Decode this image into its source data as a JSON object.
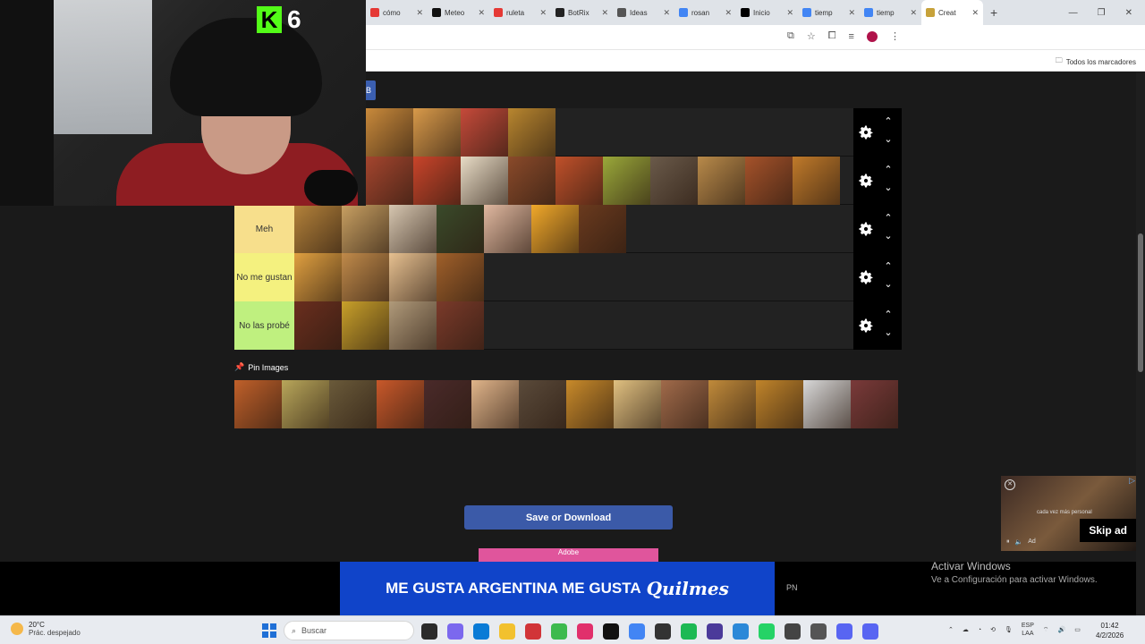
{
  "browser": {
    "tabs": [
      {
        "label": "cómo",
        "color": "#e53935"
      },
      {
        "label": "Meteo",
        "color": "#111111"
      },
      {
        "label": "ruleta",
        "color": "#e53935"
      },
      {
        "label": "BotRix",
        "color": "#222222"
      },
      {
        "label": "Ideas",
        "color": "#555555"
      },
      {
        "label": "rosan",
        "color": "#4285f4"
      },
      {
        "label": "Inicio",
        "color": "#000000"
      },
      {
        "label": "tiemp",
        "color": "#4285f4"
      },
      {
        "label": "tiemp",
        "color": "#4285f4"
      },
      {
        "label": "Creat",
        "color": "#c7a23a",
        "active": true
      }
    ],
    "new_tab_glyph": "+",
    "bookmarks_label": "Todos los marcadores"
  },
  "stream": {
    "platform_glyph": "K",
    "viewer_count": "6"
  },
  "tiers": [
    {
      "label": "",
      "color": "#222222",
      "item_colors": [
        "#c98a3b",
        "#d89a4a",
        "#c54a3a",
        "#b8862f"
      ],
      "ctl": {
        "up": "⌃",
        "down": "⌄"
      }
    },
    {
      "label": "",
      "color": "#222222",
      "item_colors": [
        "#a4452e",
        "#c9442a",
        "#e8dcc6",
        "#8a4a2a",
        "#c0502a",
        "#9aa83a",
        "#6a5a4a",
        "#b88a4a",
        "#a5522a",
        "#c07a2a"
      ],
      "ctl": {
        "up": "⌃",
        "down": "⌄"
      }
    },
    {
      "label": "Meh",
      "color": "#f7df8c",
      "item_colors": [
        "#b4823a",
        "#c8a062",
        "#d6c6b0",
        "#3a4a2a",
        "#e0b8a0",
        "#f0a82a",
        "#6a3a1e"
      ],
      "ctl": {
        "up": "⌃",
        "down": "⌄"
      }
    },
    {
      "label": "No me gustan",
      "color": "#f4f17f",
      "item_colors": [
        "#e0a040",
        "#c08a4a",
        "#e6c090",
        "#a0602a"
      ],
      "ctl": {
        "up": "⌃",
        "down": "⌄"
      }
    },
    {
      "label": "No las probé",
      "color": "#bff07f",
      "item_colors": [
        "#6a2e1e",
        "#c8a02a",
        "#b09a7a",
        "#7a3a2a"
      ],
      "ctl": {
        "up": "⌃",
        "down": "⌄"
      }
    }
  ],
  "pin": {
    "title": "Pin Images",
    "item_colors": [
      "#c0602a",
      "#b8a65a",
      "#6a5a3a",
      "#c8582a",
      "#4a2a2a",
      "#e0b48a",
      "#5a4a3a",
      "#c88a2a",
      "#e0c080",
      "#a06a4a",
      "#c08a3a",
      "#c0842a",
      "#d8d8d8",
      "#7a3a3a"
    ]
  },
  "save_button_label": "Save or Download",
  "ads": {
    "pink_ad_label": "Adobe",
    "quilmes_text": "ME GUSTA ARGENTINA ME GUSTA",
    "quilmes_brand": "Quilmes",
    "pn_label": "PN",
    "video_caption": "cada vez más personal",
    "video_ad_label": "Ad",
    "skip_label": "Skip ad"
  },
  "windows_activation": {
    "title": "Activar Windows",
    "subtitle": "Ve a Configuración para activar Windows."
  },
  "taskbar": {
    "temperature": "20°C",
    "weather": "Prác. despejado",
    "search_placeholder": "Buscar",
    "language": "ESP",
    "language_sub": "LAA",
    "time": "01:42",
    "date": "4/2/2026",
    "app_colors": [
      "#2b2b2b",
      "#7b68ee",
      "#0a7bd6",
      "#f2c12e",
      "#d13438",
      "#3dba4e",
      "#e1306c",
      "#111111",
      "#4285f4",
      "#333333",
      "#1db954",
      "#4b3a9a",
      "#2b88d8",
      "#25d366",
      "#444444",
      "#555555",
      "#5865f2",
      "#5865f2"
    ]
  }
}
